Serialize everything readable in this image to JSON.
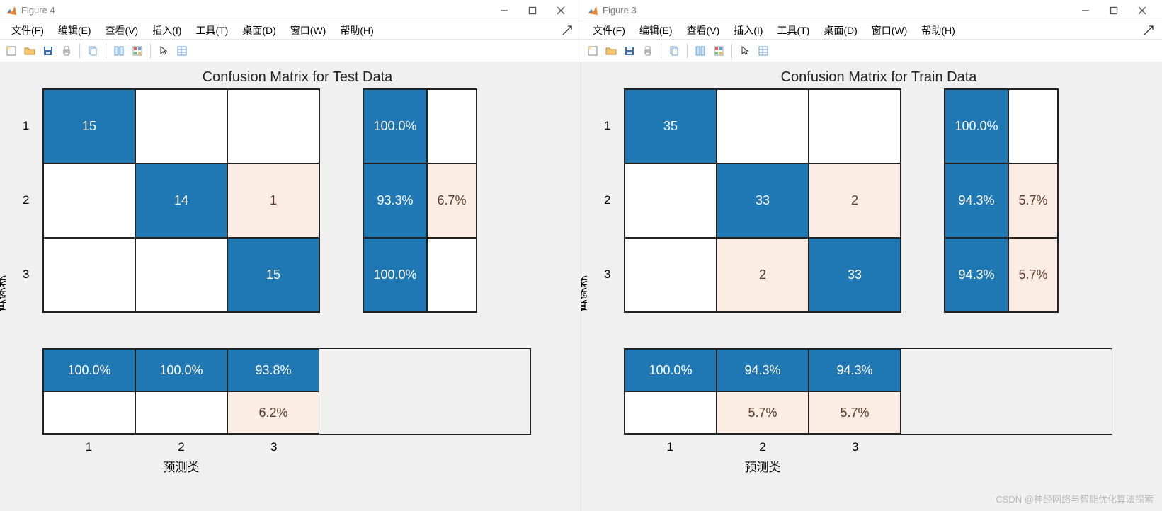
{
  "menus": {
    "file": "文件(F)",
    "edit": "编辑(E)",
    "view": "查看(V)",
    "insert": "插入(I)",
    "tools": "工具(T)",
    "desktop": "桌面(D)",
    "window": "窗口(W)",
    "help": "帮助(H)"
  },
  "axis_labels": {
    "y": "真实类",
    "x": "预测类"
  },
  "class_labels": [
    "1",
    "2",
    "3"
  ],
  "watermark": "CSDN @神经网络与智能优化算法探索",
  "figures": [
    {
      "title": "Figure 4",
      "chart_title": "Confusion Matrix for Test Data",
      "matrix": [
        [
          15,
          0,
          0
        ],
        [
          0,
          14,
          1
        ],
        [
          0,
          0,
          15
        ]
      ],
      "row_summary": [
        {
          "correct": "100.0%",
          "wrong": ""
        },
        {
          "correct": "93.3%",
          "wrong": "6.7%"
        },
        {
          "correct": "100.0%",
          "wrong": ""
        }
      ],
      "col_summary": [
        {
          "correct": "100.0%",
          "wrong": ""
        },
        {
          "correct": "100.0%",
          "wrong": ""
        },
        {
          "correct": "93.8%",
          "wrong": "6.2%"
        }
      ]
    },
    {
      "title": "Figure 3",
      "chart_title": "Confusion Matrix for Train Data",
      "matrix": [
        [
          35,
          0,
          0
        ],
        [
          0,
          33,
          2
        ],
        [
          0,
          2,
          33
        ]
      ],
      "row_summary": [
        {
          "correct": "100.0%",
          "wrong": ""
        },
        {
          "correct": "94.3%",
          "wrong": "5.7%"
        },
        {
          "correct": "94.3%",
          "wrong": "5.7%"
        }
      ],
      "col_summary": [
        {
          "correct": "100.0%",
          "wrong": ""
        },
        {
          "correct": "94.3%",
          "wrong": "5.7%"
        },
        {
          "correct": "94.3%",
          "wrong": "5.7%"
        }
      ]
    }
  ],
  "chart_data": [
    {
      "type": "heatmap",
      "title": "Confusion Matrix for Test Data",
      "xlabel": "预测类",
      "ylabel": "真实类",
      "x_categories": [
        "1",
        "2",
        "3"
      ],
      "y_categories": [
        "1",
        "2",
        "3"
      ],
      "values": [
        [
          15,
          0,
          0
        ],
        [
          0,
          14,
          1
        ],
        [
          0,
          0,
          15
        ]
      ],
      "row_precision_pct": [
        100.0,
        93.3,
        100.0
      ],
      "col_precision_pct": [
        100.0,
        100.0,
        93.8
      ]
    },
    {
      "type": "heatmap",
      "title": "Confusion Matrix for Train Data",
      "xlabel": "预测类",
      "ylabel": "真实类",
      "x_categories": [
        "1",
        "2",
        "3"
      ],
      "y_categories": [
        "1",
        "2",
        "3"
      ],
      "values": [
        [
          35,
          0,
          0
        ],
        [
          0,
          33,
          2
        ],
        [
          0,
          2,
          33
        ]
      ],
      "row_precision_pct": [
        100.0,
        94.3,
        94.3
      ],
      "col_precision_pct": [
        100.0,
        94.3,
        94.3
      ]
    }
  ]
}
